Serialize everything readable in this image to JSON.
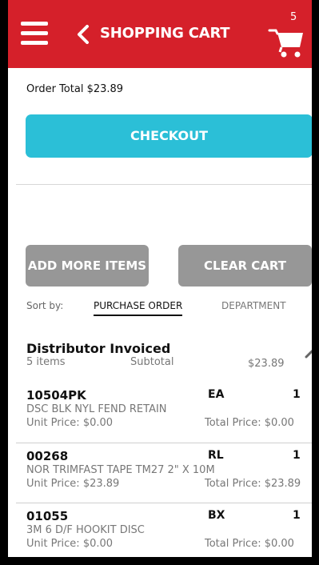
{
  "header": {
    "title": "SHOPPING CART",
    "cart_count": "5",
    "background": "#d5202a"
  },
  "order_total": "Order Total $23.89",
  "checkout_label": "CHECKOUT",
  "add_more_label": "ADD MORE ITEMS",
  "clear_cart_label": "CLEAR CART",
  "sort": {
    "label": "Sort by:",
    "options": [
      "PURCHASE ORDER",
      "DEPARTMENT"
    ],
    "selected": "PURCHASE ORDER"
  },
  "group": {
    "title": "Distributor Invoiced",
    "count": "5 items",
    "subtotal_label": "Subtotal",
    "subtotal": "$23.89"
  },
  "items": [
    {
      "sku": "10504PK",
      "uom": "EA",
      "qty": "1",
      "description": "DSC BLK NYL FEND RETAIN",
      "unit_price": "Unit Price: $0.00",
      "total_price": "Total Price: $0.00"
    },
    {
      "sku": "00268",
      "uom": "RL",
      "qty": "1",
      "description": "NOR TRIMFAST TAPE TM27 2\" X 10M",
      "unit_price": "Unit Price: $23.89",
      "total_price": "Total Price: $23.89"
    },
    {
      "sku": "01055",
      "uom": "BX",
      "qty": "1",
      "description": "3M 6 D/F HOOKIT DISC",
      "unit_price": "Unit Price: $0.00",
      "total_price": "Total Price: $0.00"
    }
  ],
  "colors": {
    "checkout": "#2bbfd7",
    "secondary_button": "#979797"
  },
  "icons": [
    "menu-icon",
    "back-chevron-icon",
    "cart-icon",
    "chevron-up-icon"
  ]
}
